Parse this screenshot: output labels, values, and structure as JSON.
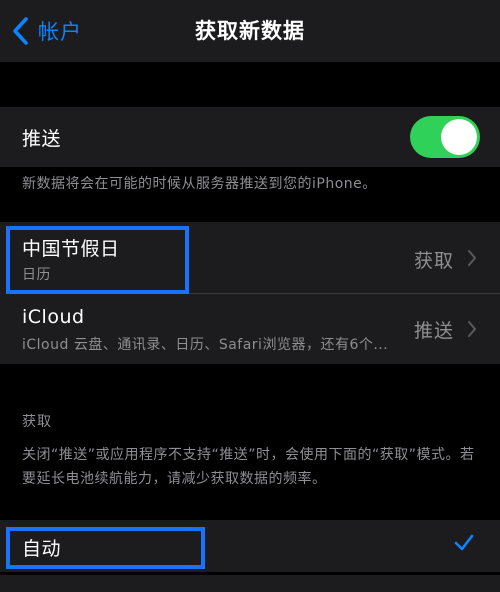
{
  "nav": {
    "back_label": "帐户",
    "title": "获取新数据"
  },
  "push": {
    "label": "推送",
    "enabled": true,
    "footer": "新数据将会在可能的时候从服务器推送到您的iPhone。"
  },
  "accounts": [
    {
      "name": "中国节假日",
      "subtitle": "日历",
      "mode": "获取"
    },
    {
      "name": "iCloud",
      "subtitle": "iCloud 云盘、通讯录、日历、Safari浏览器，还有6个...",
      "mode": "推送"
    }
  ],
  "fetch_section": {
    "header": "获取",
    "footer": "关闭“推送”或应用程序不支持“推送”时，会使用下面的“获取”模式。若要延长电池续航能力，请减少获取数据的频率。",
    "options": [
      {
        "label": "自动",
        "selected": true
      }
    ]
  },
  "colors": {
    "accent": "#0a84ff",
    "toggle_on": "#30d158",
    "highlight": "#1a73ff"
  },
  "icons": {
    "back": "chevron-left-icon",
    "disclosure": "chevron-right-icon",
    "selected": "checkmark-icon"
  }
}
